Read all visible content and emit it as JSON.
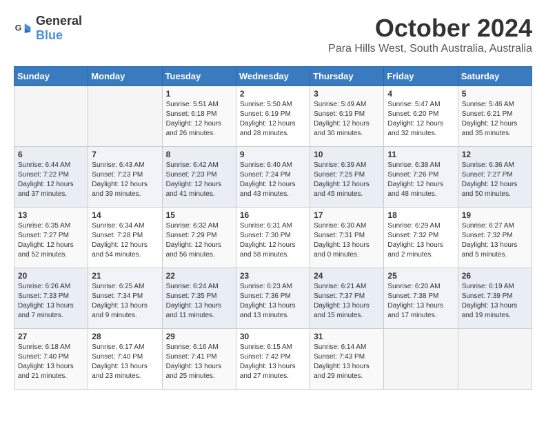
{
  "header": {
    "logo_general": "General",
    "logo_blue": "Blue",
    "month": "October 2024",
    "location": "Para Hills West, South Australia, Australia"
  },
  "weekdays": [
    "Sunday",
    "Monday",
    "Tuesday",
    "Wednesday",
    "Thursday",
    "Friday",
    "Saturday"
  ],
  "weeks": [
    [
      {
        "day": "",
        "info": ""
      },
      {
        "day": "",
        "info": ""
      },
      {
        "day": "1",
        "sunrise": "Sunrise: 5:51 AM",
        "sunset": "Sunset: 6:18 PM",
        "daylight": "Daylight: 12 hours and 26 minutes."
      },
      {
        "day": "2",
        "sunrise": "Sunrise: 5:50 AM",
        "sunset": "Sunset: 6:19 PM",
        "daylight": "Daylight: 12 hours and 28 minutes."
      },
      {
        "day": "3",
        "sunrise": "Sunrise: 5:49 AM",
        "sunset": "Sunset: 6:19 PM",
        "daylight": "Daylight: 12 hours and 30 minutes."
      },
      {
        "day": "4",
        "sunrise": "Sunrise: 5:47 AM",
        "sunset": "Sunset: 6:20 PM",
        "daylight": "Daylight: 12 hours and 32 minutes."
      },
      {
        "day": "5",
        "sunrise": "Sunrise: 5:46 AM",
        "sunset": "Sunset: 6:21 PM",
        "daylight": "Daylight: 12 hours and 35 minutes."
      }
    ],
    [
      {
        "day": "6",
        "sunrise": "Sunrise: 6:44 AM",
        "sunset": "Sunset: 7:22 PM",
        "daylight": "Daylight: 12 hours and 37 minutes."
      },
      {
        "day": "7",
        "sunrise": "Sunrise: 6:43 AM",
        "sunset": "Sunset: 7:23 PM",
        "daylight": "Daylight: 12 hours and 39 minutes."
      },
      {
        "day": "8",
        "sunrise": "Sunrise: 6:42 AM",
        "sunset": "Sunset: 7:23 PM",
        "daylight": "Daylight: 12 hours and 41 minutes."
      },
      {
        "day": "9",
        "sunrise": "Sunrise: 6:40 AM",
        "sunset": "Sunset: 7:24 PM",
        "daylight": "Daylight: 12 hours and 43 minutes."
      },
      {
        "day": "10",
        "sunrise": "Sunrise: 6:39 AM",
        "sunset": "Sunset: 7:25 PM",
        "daylight": "Daylight: 12 hours and 45 minutes."
      },
      {
        "day": "11",
        "sunrise": "Sunrise: 6:38 AM",
        "sunset": "Sunset: 7:26 PM",
        "daylight": "Daylight: 12 hours and 48 minutes."
      },
      {
        "day": "12",
        "sunrise": "Sunrise: 6:36 AM",
        "sunset": "Sunset: 7:27 PM",
        "daylight": "Daylight: 12 hours and 50 minutes."
      }
    ],
    [
      {
        "day": "13",
        "sunrise": "Sunrise: 6:35 AM",
        "sunset": "Sunset: 7:27 PM",
        "daylight": "Daylight: 12 hours and 52 minutes."
      },
      {
        "day": "14",
        "sunrise": "Sunrise: 6:34 AM",
        "sunset": "Sunset: 7:28 PM",
        "daylight": "Daylight: 12 hours and 54 minutes."
      },
      {
        "day": "15",
        "sunrise": "Sunrise: 6:32 AM",
        "sunset": "Sunset: 7:29 PM",
        "daylight": "Daylight: 12 hours and 56 minutes."
      },
      {
        "day": "16",
        "sunrise": "Sunrise: 6:31 AM",
        "sunset": "Sunset: 7:30 PM",
        "daylight": "Daylight: 12 hours and 58 minutes."
      },
      {
        "day": "17",
        "sunrise": "Sunrise: 6:30 AM",
        "sunset": "Sunset: 7:31 PM",
        "daylight": "Daylight: 13 hours and 0 minutes."
      },
      {
        "day": "18",
        "sunrise": "Sunrise: 6:29 AM",
        "sunset": "Sunset: 7:32 PM",
        "daylight": "Daylight: 13 hours and 2 minutes."
      },
      {
        "day": "19",
        "sunrise": "Sunrise: 6:27 AM",
        "sunset": "Sunset: 7:32 PM",
        "daylight": "Daylight: 13 hours and 5 minutes."
      }
    ],
    [
      {
        "day": "20",
        "sunrise": "Sunrise: 6:26 AM",
        "sunset": "Sunset: 7:33 PM",
        "daylight": "Daylight: 13 hours and 7 minutes."
      },
      {
        "day": "21",
        "sunrise": "Sunrise: 6:25 AM",
        "sunset": "Sunset: 7:34 PM",
        "daylight": "Daylight: 13 hours and 9 minutes."
      },
      {
        "day": "22",
        "sunrise": "Sunrise: 6:24 AM",
        "sunset": "Sunset: 7:35 PM",
        "daylight": "Daylight: 13 hours and 11 minutes."
      },
      {
        "day": "23",
        "sunrise": "Sunrise: 6:23 AM",
        "sunset": "Sunset: 7:36 PM",
        "daylight": "Daylight: 13 hours and 13 minutes."
      },
      {
        "day": "24",
        "sunrise": "Sunrise: 6:21 AM",
        "sunset": "Sunset: 7:37 PM",
        "daylight": "Daylight: 13 hours and 15 minutes."
      },
      {
        "day": "25",
        "sunrise": "Sunrise: 6:20 AM",
        "sunset": "Sunset: 7:38 PM",
        "daylight": "Daylight: 13 hours and 17 minutes."
      },
      {
        "day": "26",
        "sunrise": "Sunrise: 6:19 AM",
        "sunset": "Sunset: 7:39 PM",
        "daylight": "Daylight: 13 hours and 19 minutes."
      }
    ],
    [
      {
        "day": "27",
        "sunrise": "Sunrise: 6:18 AM",
        "sunset": "Sunset: 7:40 PM",
        "daylight": "Daylight: 13 hours and 21 minutes."
      },
      {
        "day": "28",
        "sunrise": "Sunrise: 6:17 AM",
        "sunset": "Sunset: 7:40 PM",
        "daylight": "Daylight: 13 hours and 23 minutes."
      },
      {
        "day": "29",
        "sunrise": "Sunrise: 6:16 AM",
        "sunset": "Sunset: 7:41 PM",
        "daylight": "Daylight: 13 hours and 25 minutes."
      },
      {
        "day": "30",
        "sunrise": "Sunrise: 6:15 AM",
        "sunset": "Sunset: 7:42 PM",
        "daylight": "Daylight: 13 hours and 27 minutes."
      },
      {
        "day": "31",
        "sunrise": "Sunrise: 6:14 AM",
        "sunset": "Sunset: 7:43 PM",
        "daylight": "Daylight: 13 hours and 29 minutes."
      },
      {
        "day": "",
        "info": ""
      },
      {
        "day": "",
        "info": ""
      }
    ]
  ]
}
